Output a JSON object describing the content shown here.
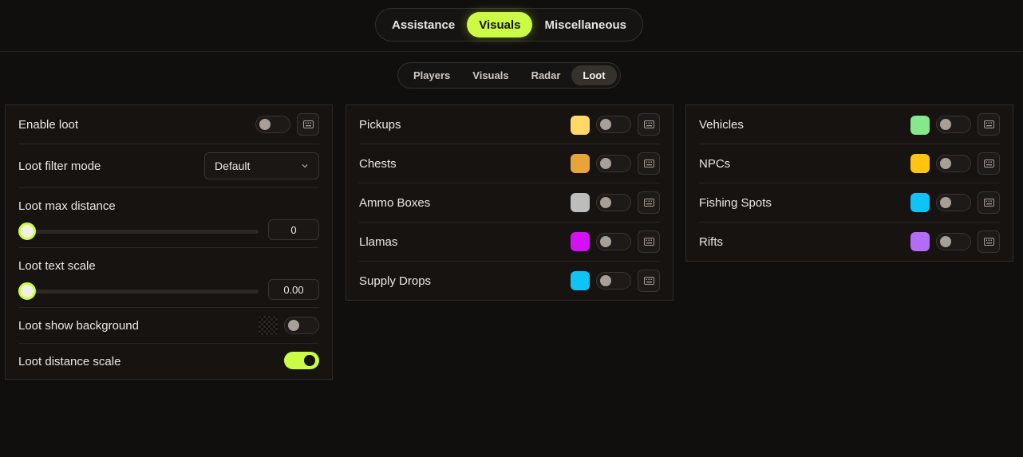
{
  "main_tabs": [
    {
      "label": "Assistance",
      "active": false
    },
    {
      "label": "Visuals",
      "active": true
    },
    {
      "label": "Miscellaneous",
      "active": false
    }
  ],
  "sub_tabs": [
    {
      "label": "Players",
      "active": false
    },
    {
      "label": "Visuals",
      "active": false
    },
    {
      "label": "Radar",
      "active": false
    },
    {
      "label": "Loot",
      "active": true
    }
  ],
  "loot_panel": {
    "enable_loot": {
      "label": "Enable loot",
      "on": false
    },
    "filter_mode": {
      "label": "Loot filter mode",
      "value": "Default"
    },
    "max_distance": {
      "label": "Loot max distance",
      "value": "0",
      "fraction": 0
    },
    "text_scale": {
      "label": "Loot text scale",
      "value": "0.00",
      "fraction": 0
    },
    "show_background": {
      "label": "Loot show background",
      "on": false
    },
    "distance_scale": {
      "label": "Loot distance scale",
      "on": true
    }
  },
  "pickups_panel": {
    "items": [
      {
        "label": "Pickups",
        "color": "#ffd866",
        "on": false
      },
      {
        "label": "Chests",
        "color": "#e8a33a",
        "on": false
      },
      {
        "label": "Ammo Boxes",
        "color": "#bdbdbd",
        "on": false
      },
      {
        "label": "Llamas",
        "color": "#d410f5",
        "on": false
      },
      {
        "label": "Supply Drops",
        "color": "#10c3f5",
        "on": false
      }
    ]
  },
  "world_panel": {
    "items": [
      {
        "label": "Vehicles",
        "color": "#86e88a",
        "on": false
      },
      {
        "label": "NPCs",
        "color": "#ffc40f",
        "on": false
      },
      {
        "label": "Fishing Spots",
        "color": "#10c3f5",
        "on": false
      },
      {
        "label": "Rifts",
        "color": "#b26cf5",
        "on": false
      }
    ]
  },
  "icons": {
    "keybind": "keyboard-icon",
    "dropdown": "chevron-down-icon"
  }
}
